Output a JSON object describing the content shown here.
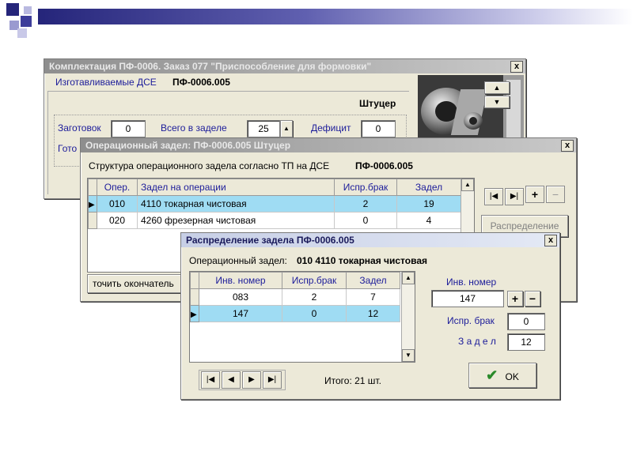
{
  "colors": {
    "selection": "#9fdcf3",
    "header_text": "#1c1c9a",
    "ok_check": "#2a8a2a"
  },
  "win1": {
    "title": "Комплектация ПФ-0006.  Заказ 077  \"Приспособление для формовки\"",
    "close": "x",
    "dse_label": "Изготавливаемые ДСЕ",
    "dse_code": "ПФ-0006.005",
    "part_name": "Штуцер",
    "zagotovok_label": "Заготовок",
    "zagotovok_value": "0",
    "vsego_label": "Всего в заделе",
    "vsego_value": "25",
    "deficit_label": "Дефицит",
    "deficit_value": "0",
    "goto_label": "Гото"
  },
  "win2": {
    "title": "Операционный задел:  ПФ-0006.005     Штуцер",
    "close": "x",
    "struct_label": "Структура операционного задела согласно ТП на ДСЕ",
    "struct_code": "ПФ-0006.005",
    "columns": [
      "Опер.",
      "Задел на операции",
      "Испр.брак",
      "Задел"
    ],
    "rows": [
      {
        "op": "010",
        "name": "4110 токарная чистовая",
        "brak": "2",
        "zadel": "19"
      },
      {
        "op": "020",
        "name": "4260 фрезерная чистовая",
        "brak": "0",
        "zadel": "4"
      }
    ],
    "raspr_button": "Распределение",
    "bottom_text": "точить окончатель"
  },
  "win3": {
    "title": "Распределение задела  ПФ-0006.005",
    "close": "x",
    "op_label": "Операционный задел:",
    "op_value": "010   4110 токарная чистовая",
    "columns": [
      "Инв. номер",
      "Испр.брак",
      "Задел"
    ],
    "rows": [
      {
        "inv": "083",
        "brak": "2",
        "zadel": "7"
      },
      {
        "inv": "147",
        "brak": "0",
        "zadel": "12"
      }
    ],
    "inv_label": "Инв. номер",
    "inv_value": "147",
    "brak_label": "Испр. брак",
    "brak_value": "0",
    "zadel_label": "З а д е л",
    "zadel_value": "12",
    "total": "Итого:  21 шт.",
    "ok_label": "OK"
  }
}
